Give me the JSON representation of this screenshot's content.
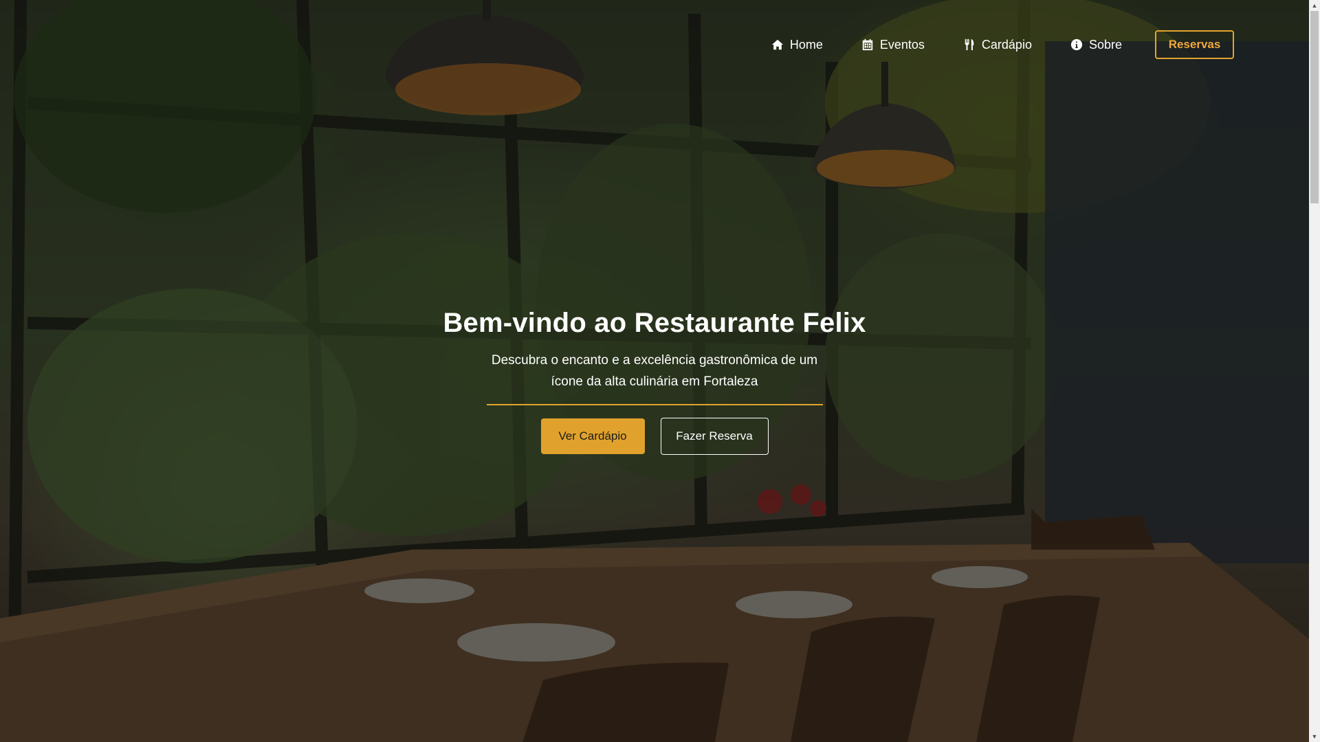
{
  "nav": {
    "items": [
      {
        "label": "Home",
        "icon": "home-icon"
      },
      {
        "label": "Eventos",
        "icon": "calendar-icon"
      },
      {
        "label": "Cardápio",
        "icon": "utensils-icon"
      },
      {
        "label": "Sobre",
        "icon": "info-icon"
      }
    ],
    "cta_label": "Reservas"
  },
  "hero": {
    "title": "Bem-vindo ao Restaurante Felix",
    "subtitle": "Descubra o encanto e a excelência gastronômica de um ícone da alta culinária em Fortaleza",
    "primary_button": "Ver Cardápio",
    "secondary_button": "Fazer Reserva"
  },
  "colors": {
    "accent": "#e0a22c",
    "text": "#ffffff"
  }
}
